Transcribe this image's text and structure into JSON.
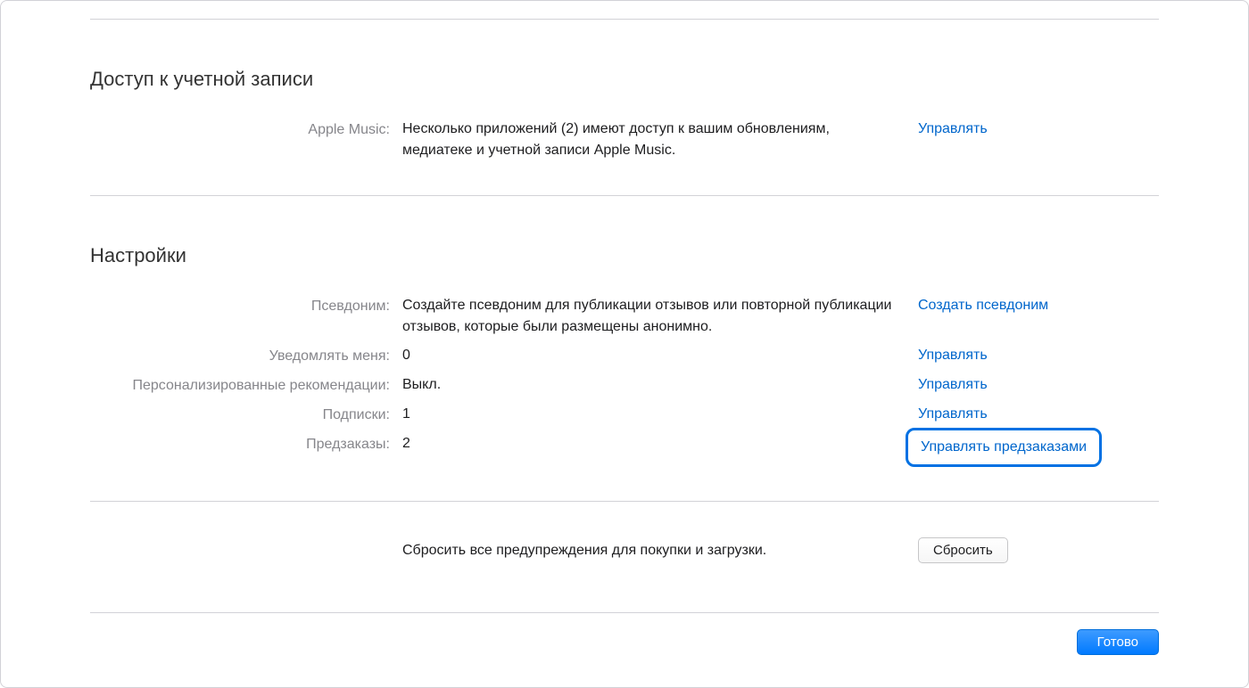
{
  "account_access": {
    "title": "Доступ к учетной записи",
    "rows": [
      {
        "label": "Apple Music:",
        "value": "Несколько приложений (2) имеют доступ к вашим обновлениям, медиатеке и учетной записи Apple Music.",
        "action": "Управлять"
      }
    ]
  },
  "settings": {
    "title": "Настройки",
    "nickname": {
      "label": "Псевдоним:",
      "value": "Создайте псевдоним для публикации отзывов или повторной публикации отзывов, которые были размещены анонимно.",
      "action": "Создать псевдоним"
    },
    "notify": {
      "label": "Уведомлять меня:",
      "value": "0",
      "action": "Управлять"
    },
    "recommendations": {
      "label": "Персонализированные рекомендации:",
      "value": "Выкл.",
      "action": "Управлять"
    },
    "subscriptions": {
      "label": "Подписки:",
      "value": "1",
      "action": "Управлять"
    },
    "preorders": {
      "label": "Предзаказы:",
      "value": "2",
      "action": "Управлять предзаказами"
    }
  },
  "reset": {
    "text": "Сбросить все предупреждения для покупки и загрузки.",
    "button": "Сбросить"
  },
  "footer": {
    "done": "Готово"
  }
}
